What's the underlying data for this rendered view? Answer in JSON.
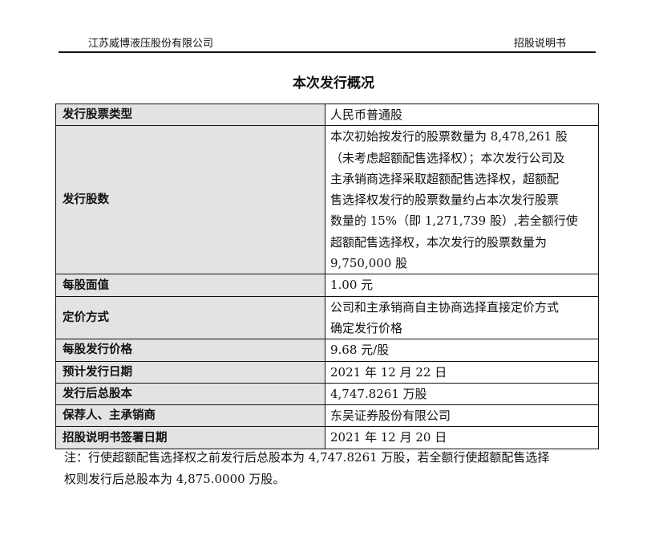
{
  "header": {
    "company": "江苏威博液压股份有限公司",
    "doc_type": "招股说明书"
  },
  "title": "本次发行概况",
  "table": {
    "rows": [
      {
        "label": "发行股票类型",
        "value": "人民币普通股"
      },
      {
        "label": "发行股数",
        "value_lines": [
          "本次初始按发行的股票数量为 8,478,261 股",
          "（未考虑超额配售选择权）；本次发行公司及",
          "主承销商选择采取超额配售选择权，超额配",
          "售选择权发行的股票数量约占本次发行股票",
          "数量的 15%（即 1,271,739 股）,若全额行使",
          "超额配售选择权，本次发行的股票数量为",
          "9,750,000 股"
        ]
      },
      {
        "label": "每股面值",
        "value": "1.00 元"
      },
      {
        "label": "定价方式",
        "value_lines": [
          "公司和主承销商自主协商选择直接定价方式",
          "确定发行价格"
        ]
      },
      {
        "label": "每股发行价格",
        "value": "9.68 元/股"
      },
      {
        "label": "预计发行日期",
        "value": "2021 年 12 月 22 日"
      },
      {
        "label": "发行后总股本",
        "value": "4,747.8261 万股"
      },
      {
        "label": "保荐人、主承销商",
        "value": "东吴证券股份有限公司"
      },
      {
        "label": "招股说明书签署日期",
        "value": "2021 年 12 月 20 日"
      }
    ]
  },
  "note": {
    "line1": "注：行使超额配售选择权之前发行后总股本为 4,747.8261 万股，若全额行使超额配售选择",
    "line2": "权则发行后总股本为 4,875.0000 万股。"
  }
}
